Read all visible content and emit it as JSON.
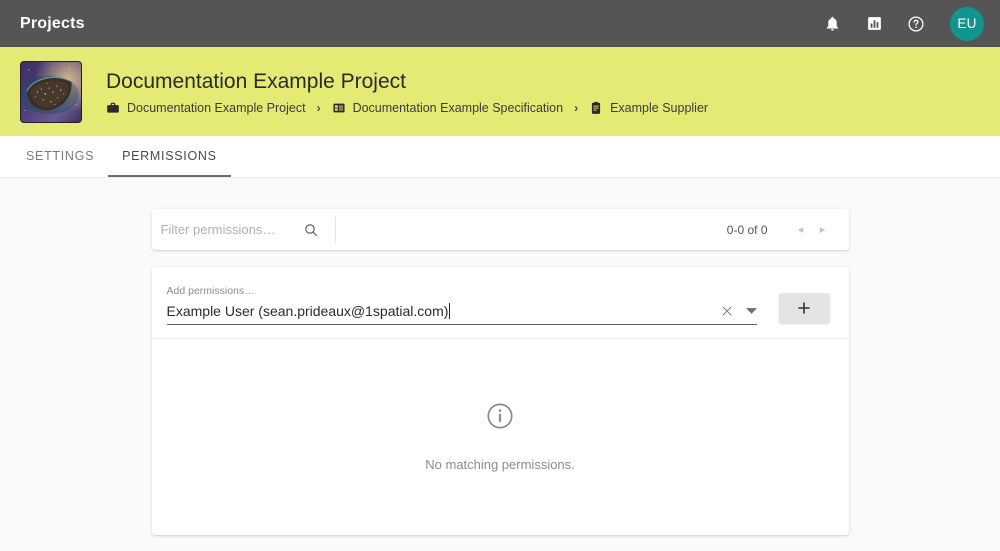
{
  "topbar": {
    "title": "Projects",
    "icons": [
      {
        "name": "notifications-icon",
        "label": "bell-icon"
      },
      {
        "name": "reports-icon",
        "label": "bar-chart-icon"
      },
      {
        "name": "help-icon",
        "label": "question-circle-icon"
      }
    ],
    "avatar_initials": "EU",
    "avatar_color": "#129490"
  },
  "banner": {
    "background_color": "#e4ea74",
    "project_title": "Documentation Example Project",
    "thumbnail_name": "earth-at-night-thumbnail",
    "breadcrumbs": [
      {
        "icon": "briefcase-icon",
        "label": "Documentation Example Project"
      },
      {
        "icon": "specification-icon",
        "label": "Documentation Example Specification"
      },
      {
        "icon": "supplier-clipboard-icon",
        "label": "Example Supplier"
      }
    ],
    "separator": "›"
  },
  "tabs": [
    {
      "label": "SETTINGS",
      "active": false
    },
    {
      "label": "PERMISSIONS",
      "active": true
    }
  ],
  "filter_bar": {
    "placeholder": "Filter permissions…",
    "value": "",
    "search_icon": "search-icon",
    "pagination_label": "0-0 of 0",
    "prev_arrow": "◂",
    "next_arrow": "▸"
  },
  "add_permissions": {
    "label": "Add permissions…",
    "value": "Example User (sean.prideaux@1spatial.com)",
    "clear_icon": "close-icon",
    "dropdown_icon": "chevron-down-icon",
    "add_button_label": "+"
  },
  "empty_state": {
    "icon": "info-circle-icon",
    "message": "No matching permissions."
  }
}
